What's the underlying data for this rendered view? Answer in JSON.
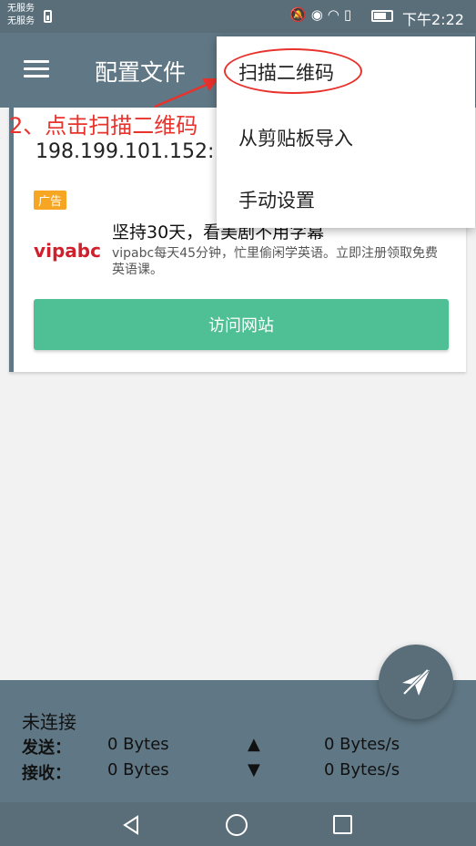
{
  "status_bar": {
    "carrier_line1": "无服务",
    "carrier_line2": "无服务",
    "icons": [
      "mute-icon",
      "eye-icon",
      "wifi-icon",
      "data-icon",
      "battery-icon"
    ],
    "time": "下午2:22"
  },
  "toolbar": {
    "title": "配置文件"
  },
  "card": {
    "server_address": "198.199.101.152:",
    "ad_badge": "广告",
    "ad_logo": "vipabc",
    "ad_title": "坚持30天，看美剧不用字幕",
    "ad_description": "vipabc每天45分钟，忙里偷闲学英语。立即注册领取免费英语课。",
    "visit_button": "访问网站"
  },
  "annotation": {
    "text": "2、点击扫描二维码",
    "color": "#e8322c"
  },
  "popup_menu": {
    "items": [
      {
        "label": "扫描二维码"
      },
      {
        "label": "从剪贴板导入"
      },
      {
        "label": "手动设置"
      }
    ]
  },
  "status_panel": {
    "connection": "未连接",
    "send_label": "发送：",
    "send_total": "0 Bytes",
    "send_arrow": "▲",
    "send_rate": "0 Bytes/s",
    "receive_label": "接收：",
    "receive_total": "0 Bytes",
    "receive_arrow": "▼",
    "receive_rate": "0 Bytes/s"
  },
  "colors": {
    "primary": "#607885",
    "accent_green": "#4fc095",
    "ad_badge": "#f6a623",
    "annotation_red": "#e8322c"
  }
}
